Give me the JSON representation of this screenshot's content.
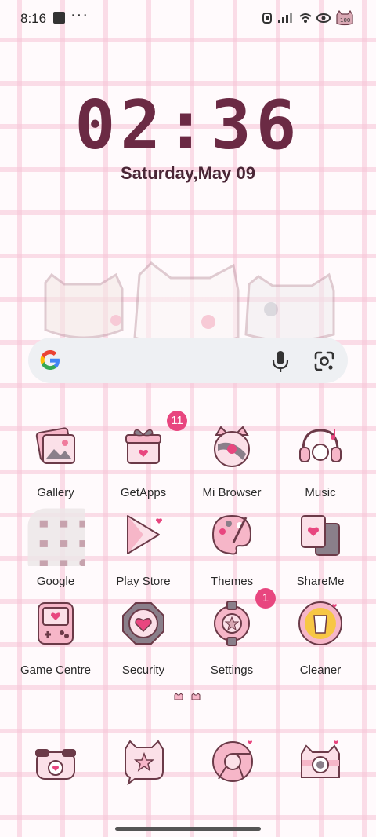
{
  "status_bar": {
    "time": "8:16",
    "more": "···"
  },
  "clock": {
    "time": "02:36",
    "date": "Saturday,May 09"
  },
  "apps": [
    {
      "label": "Gallery",
      "icon": "gallery-icon"
    },
    {
      "label": "GetApps",
      "icon": "getapps-icon",
      "badge": "11"
    },
    {
      "label": "Mi Browser",
      "icon": "mi-browser-icon"
    },
    {
      "label": "Music",
      "icon": "music-icon"
    },
    {
      "label": "Google",
      "icon": "google-folder-icon"
    },
    {
      "label": "Play Store",
      "icon": "play-store-icon"
    },
    {
      "label": "Themes",
      "icon": "themes-icon"
    },
    {
      "label": "ShareMe",
      "icon": "shareme-icon"
    },
    {
      "label": "Game Centre",
      "icon": "game-centre-icon"
    },
    {
      "label": "Security",
      "icon": "security-icon"
    },
    {
      "label": "Settings",
      "icon": "settings-icon",
      "badge": "1"
    },
    {
      "label": "Cleaner",
      "icon": "cleaner-icon"
    }
  ],
  "dock": [
    "phone-icon",
    "messaging-icon",
    "browser-icon",
    "camera-icon"
  ]
}
